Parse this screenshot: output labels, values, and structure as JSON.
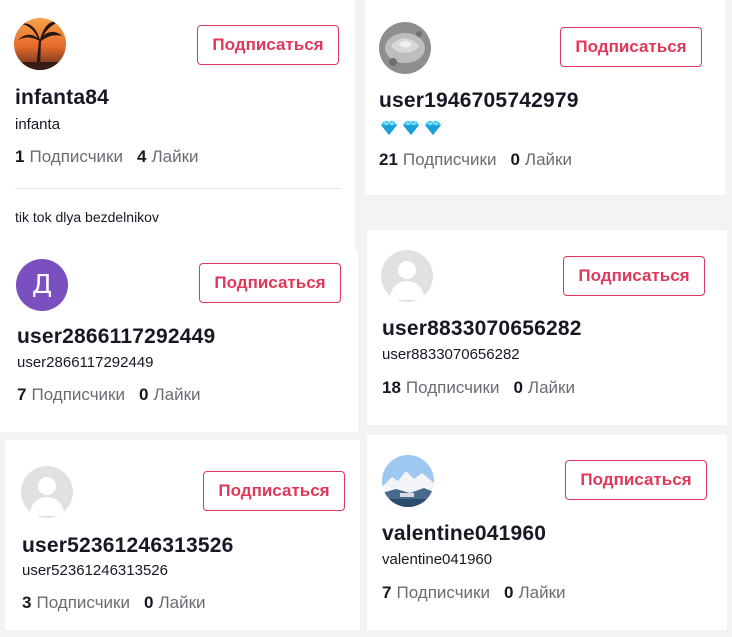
{
  "follow_label": "Подписаться",
  "followers_label": "Подписчики",
  "likes_label": "Лайки",
  "cards": [
    {
      "username": "infanta84",
      "nickname": "infanta",
      "followers": "1",
      "likes": "4",
      "bio": "tik tok dlya bezdelnikov",
      "avatar": "sunset-palm-photo"
    },
    {
      "username": "user1946705742979",
      "nickname_icons": [
        "diamond-icon",
        "diamond-icon",
        "diamond-icon"
      ],
      "followers": "21",
      "likes": "0",
      "avatar": "grey-stone-photo"
    },
    {
      "username": "user2866117292449",
      "nickname": "user2866117292449",
      "followers": "7",
      "likes": "0",
      "avatar_letter": "Д",
      "avatar_color": "#7a4fc0"
    },
    {
      "username": "user8833070656282",
      "nickname": "user8833070656282",
      "followers": "18",
      "likes": "0",
      "avatar": "default-user-icon"
    },
    {
      "username": "user52361246313526",
      "nickname": "user52361246313526",
      "followers": "3",
      "likes": "0",
      "avatar": "default-user-icon"
    },
    {
      "username": "valentine041960",
      "nickname": "valentine041960",
      "followers": "7",
      "likes": "0",
      "avatar": "snowy-mountain-photo"
    }
  ],
  "colors": {
    "accent": "#e0385a",
    "muted_text": "#6b6c73",
    "letter_avatar": "#7a4fc0"
  }
}
